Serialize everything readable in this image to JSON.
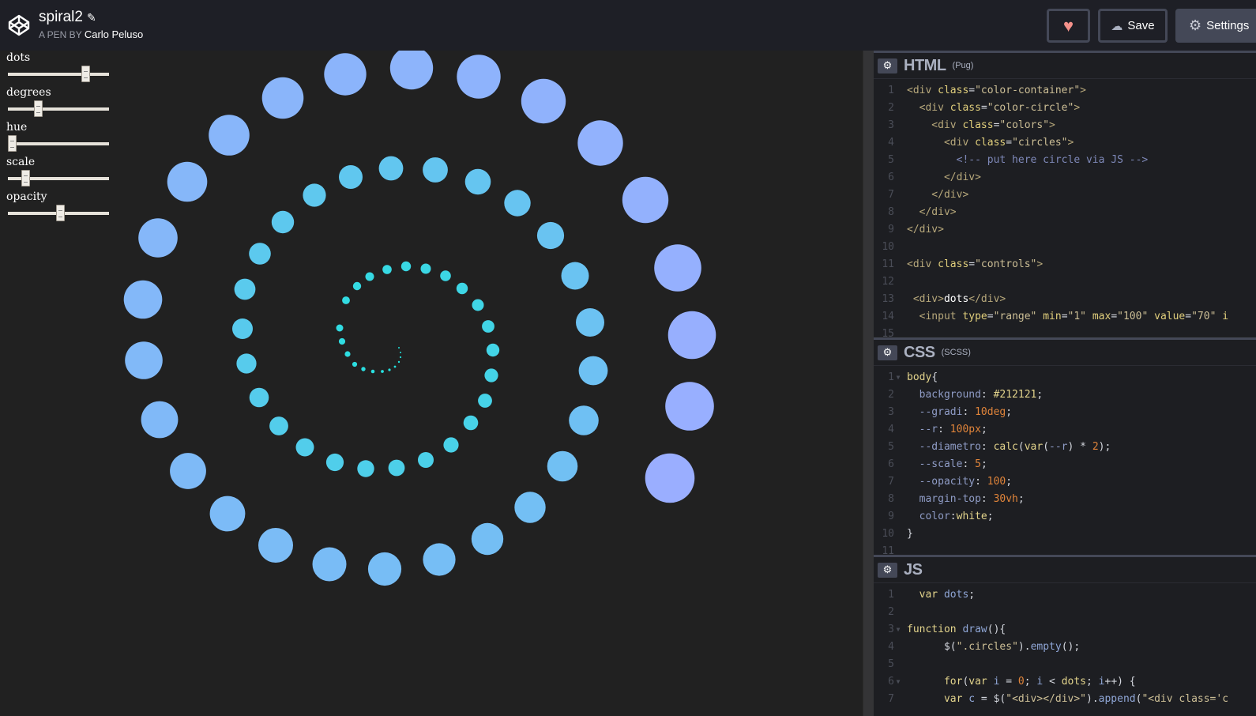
{
  "header": {
    "title": "spiral2",
    "byline_prefix": "A PEN BY",
    "author": "Carlo Peluso",
    "save_label": "Save",
    "settings_label": "Settings",
    "heart_color": "#f4918b"
  },
  "controls": [
    {
      "label": "dots",
      "value": 0.77
    },
    {
      "label": "degrees",
      "value": 0.27
    },
    {
      "label": "hue",
      "value": 0.0
    },
    {
      "label": "scale",
      "value": 0.14
    },
    {
      "label": "opacity",
      "value": 0.5
    }
  ],
  "spiral": {
    "dot_count": 70,
    "inner_color": "#1de4dc",
    "outer_color": "#9aaeff"
  },
  "panels": [
    {
      "name": "HTML",
      "sub": "(Pug)",
      "lines": [
        [
          [
            "tag",
            "<div "
          ],
          [
            "attr",
            "class"
          ],
          [
            "plain",
            "="
          ],
          [
            "str",
            "\"color-container\""
          ],
          [
            "tag",
            ">"
          ]
        ],
        [
          [
            "tag",
            "  <div "
          ],
          [
            "attr",
            "class"
          ],
          [
            "plain",
            "="
          ],
          [
            "str",
            "\"color-circle\""
          ],
          [
            "tag",
            ">"
          ]
        ],
        [
          [
            "tag",
            "    <div "
          ],
          [
            "attr",
            "class"
          ],
          [
            "plain",
            "="
          ],
          [
            "str",
            "\"colors\""
          ],
          [
            "tag",
            ">"
          ]
        ],
        [
          [
            "tag",
            "      <div "
          ],
          [
            "attr",
            "class"
          ],
          [
            "plain",
            "="
          ],
          [
            "str",
            "\"circles\""
          ],
          [
            "tag",
            ">"
          ]
        ],
        [
          [
            "com",
            "        <!-- put here circle via JS -->"
          ]
        ],
        [
          [
            "tag",
            "      </div>"
          ]
        ],
        [
          [
            "tag",
            "    </div>"
          ]
        ],
        [
          [
            "tag",
            "  </div>"
          ]
        ],
        [
          [
            "tag",
            "</div>"
          ]
        ],
        [],
        [
          [
            "tag",
            "<div "
          ],
          [
            "attr",
            "class"
          ],
          [
            "plain",
            "="
          ],
          [
            "str",
            "\"controls\""
          ],
          [
            "tag",
            ">"
          ]
        ],
        [],
        [
          [
            "tag",
            " <div>"
          ],
          [
            "txt",
            "dots"
          ],
          [
            "tag",
            "</div>"
          ]
        ],
        [
          [
            "tag",
            "  <input "
          ],
          [
            "attr",
            "type"
          ],
          [
            "plain",
            "="
          ],
          [
            "str",
            "\"range\" "
          ],
          [
            "attr",
            "min"
          ],
          [
            "plain",
            "="
          ],
          [
            "str",
            "\"1\" "
          ],
          [
            "attr",
            "max"
          ],
          [
            "plain",
            "="
          ],
          [
            "str",
            "\"100\" "
          ],
          [
            "attr",
            "value"
          ],
          [
            "plain",
            "="
          ],
          [
            "str",
            "\"70\" "
          ],
          [
            "attr",
            "i"
          ]
        ],
        []
      ]
    },
    {
      "name": "CSS",
      "sub": "(SCSS)",
      "lines": [
        [
          [
            "kw",
            "body"
          ],
          [
            "plain",
            "{"
          ]
        ],
        [
          [
            "prop",
            "  background"
          ],
          [
            "plain",
            ": "
          ],
          [
            "kw",
            "#212121"
          ],
          [
            "plain",
            ";"
          ]
        ],
        [
          [
            "prop",
            "  --gradi"
          ],
          [
            "plain",
            ": "
          ],
          [
            "num",
            "10deg"
          ],
          [
            "plain",
            ";"
          ]
        ],
        [
          [
            "prop",
            "  --r"
          ],
          [
            "plain",
            ": "
          ],
          [
            "num",
            "100px"
          ],
          [
            "plain",
            ";"
          ]
        ],
        [
          [
            "prop",
            "  --diametro"
          ],
          [
            "plain",
            ": "
          ],
          [
            "kw",
            "calc"
          ],
          [
            "plain",
            "("
          ],
          [
            "kw",
            "var"
          ],
          [
            "plain",
            "("
          ],
          [
            "prop",
            "--r"
          ],
          [
            "plain",
            ") * "
          ],
          [
            "num",
            "2"
          ],
          [
            "plain",
            ");"
          ]
        ],
        [
          [
            "prop",
            "  --scale"
          ],
          [
            "plain",
            ": "
          ],
          [
            "num",
            "5"
          ],
          [
            "plain",
            ";"
          ]
        ],
        [
          [
            "prop",
            "  --opacity"
          ],
          [
            "plain",
            ": "
          ],
          [
            "num",
            "100"
          ],
          [
            "plain",
            ";"
          ]
        ],
        [
          [
            "prop",
            "  margin-top"
          ],
          [
            "plain",
            ": "
          ],
          [
            "num",
            "30vh"
          ],
          [
            "plain",
            ";"
          ]
        ],
        [
          [
            "prop",
            "  color"
          ],
          [
            "plain",
            ":"
          ],
          [
            "kw",
            "white"
          ],
          [
            "plain",
            ";"
          ]
        ],
        [
          [
            "plain",
            "}"
          ]
        ],
        []
      ]
    },
    {
      "name": "JS",
      "sub": "",
      "lines": [
        [
          [
            "kw",
            "  var "
          ],
          [
            "fn",
            "dots"
          ],
          [
            "plain",
            ";"
          ]
        ],
        [],
        [
          [
            "kw",
            "function "
          ],
          [
            "fn",
            "draw"
          ],
          [
            "plain",
            "(){"
          ]
        ],
        [
          [
            "plain",
            "      $("
          ],
          [
            "str",
            "\".circles\""
          ],
          [
            "plain",
            ")."
          ],
          [
            "fn",
            "empty"
          ],
          [
            "plain",
            "();"
          ]
        ],
        [],
        [
          [
            "kw",
            "      for"
          ],
          [
            "plain",
            "("
          ],
          [
            "kw",
            "var "
          ],
          [
            "fn",
            "i"
          ],
          [
            "plain",
            " = "
          ],
          [
            "num",
            "0"
          ],
          [
            "plain",
            "; "
          ],
          [
            "fn",
            "i"
          ],
          [
            "plain",
            " < "
          ],
          [
            "kw",
            "dots"
          ],
          [
            "plain",
            "; "
          ],
          [
            "fn",
            "i"
          ],
          [
            "plain",
            "++) {"
          ]
        ],
        [
          [
            "kw",
            "      var "
          ],
          [
            "fn",
            "c"
          ],
          [
            "plain",
            " = $("
          ],
          [
            "str",
            "\"<div></div>\""
          ],
          [
            "plain",
            ")."
          ],
          [
            "fn",
            "append"
          ],
          [
            "plain",
            "("
          ],
          [
            "str",
            "\"<div class='c"
          ]
        ]
      ]
    }
  ]
}
